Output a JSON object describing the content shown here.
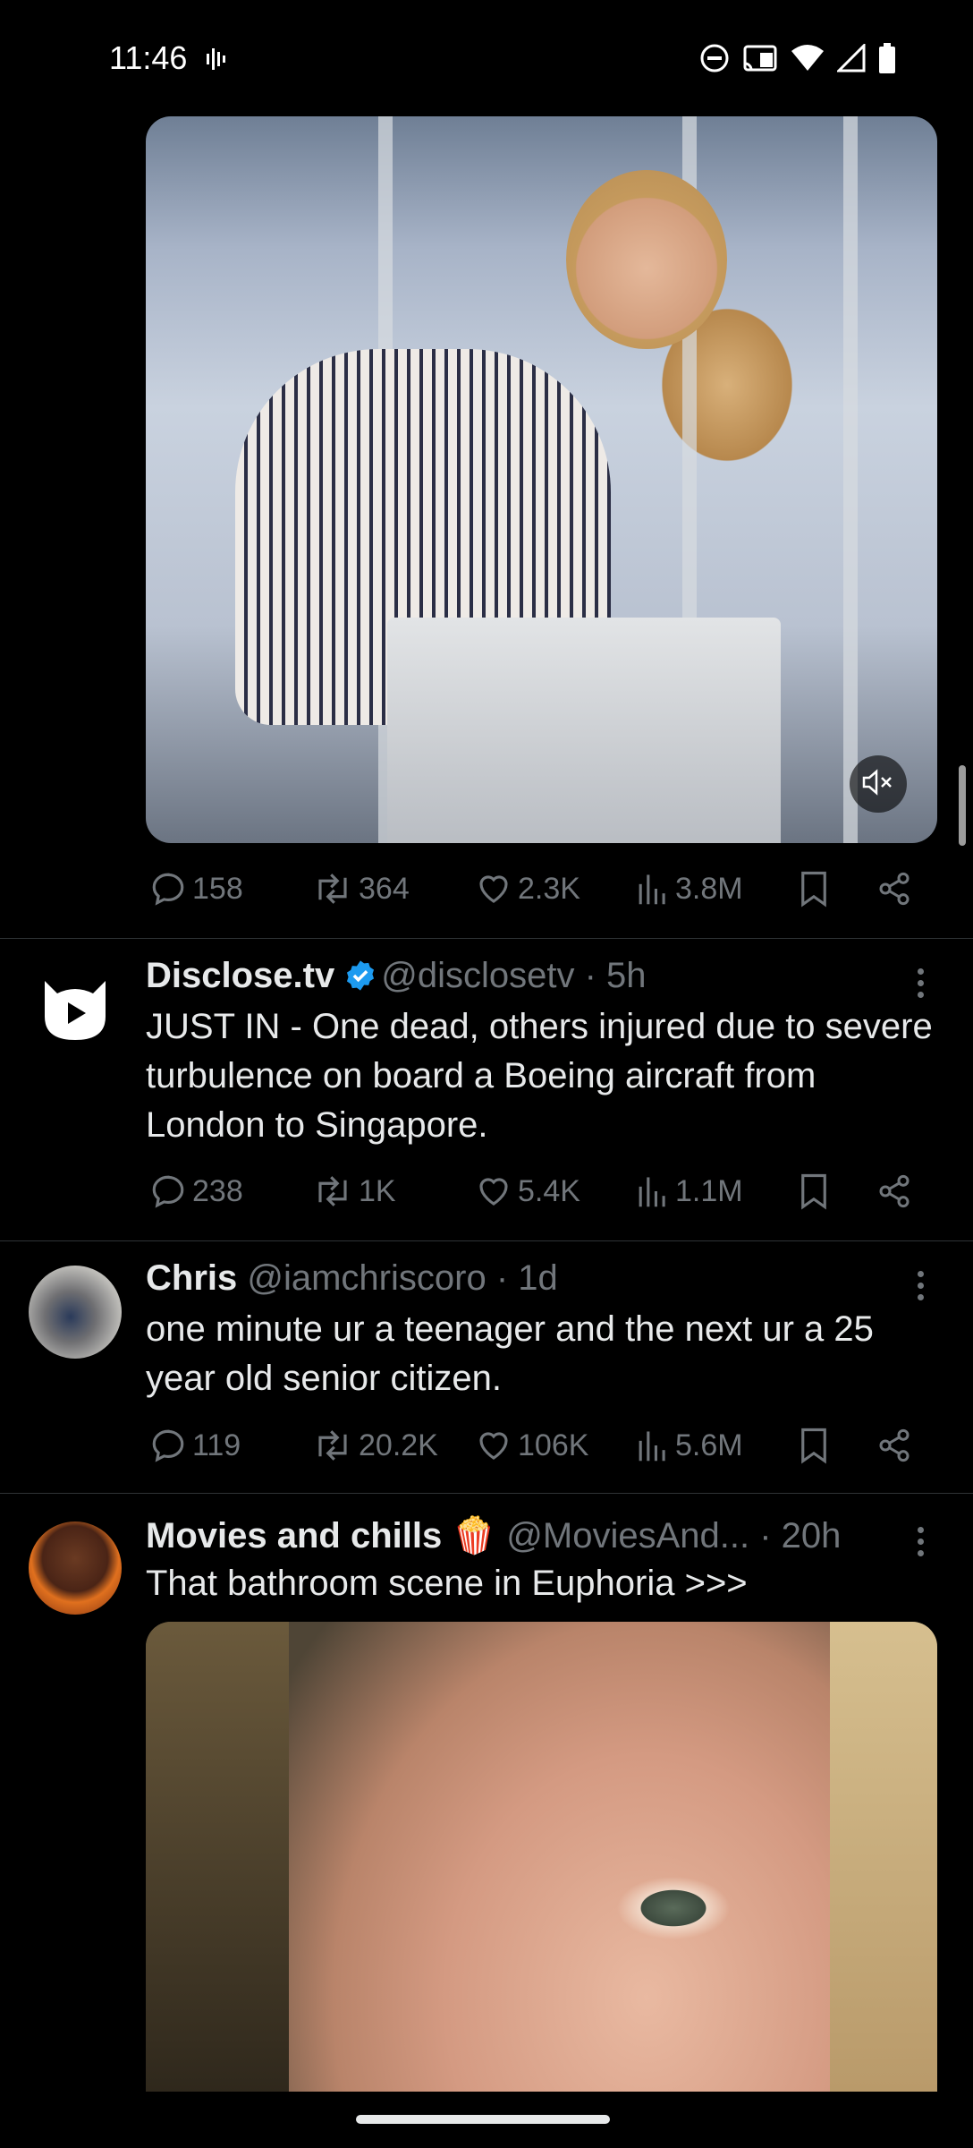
{
  "status_bar": {
    "time": "11:46"
  },
  "tweets": [
    {
      "stats": {
        "replies": "158",
        "retweets": "364",
        "likes": "2.3K",
        "views": "3.8M"
      }
    },
    {
      "display_name": "Disclose.tv",
      "verified": true,
      "handle": "@disclosetv",
      "time": "· 5h",
      "text": "JUST IN - One dead, others injured due to severe turbulence on board a Boeing aircraft from London to Singapore.",
      "stats": {
        "replies": "238",
        "retweets": "1K",
        "likes": "5.4K",
        "views": "1.1M"
      }
    },
    {
      "display_name": "Chris",
      "handle": "@iamchriscoro",
      "time": "· 1d",
      "text": "one minute ur a teenager and the next ur a 25 year old senior citizen.",
      "stats": {
        "replies": "119",
        "retweets": "20.2K",
        "likes": "106K",
        "views": "5.6M"
      }
    },
    {
      "display_name": "Movies and chills 🍿",
      "handle": "@MoviesAnd...",
      "time": "· 20h",
      "text": "That bathroom scene in Euphoria >>>"
    }
  ],
  "colors": {
    "background": "#000000",
    "text": "#e7e9ea",
    "muted": "#71767b",
    "verified": "#1d9bf0",
    "divider": "#2f3336"
  },
  "icons": [
    "reply-icon",
    "retweet-icon",
    "like-icon",
    "views-icon",
    "bookmark-icon",
    "share-icon",
    "mute-icon",
    "more-icon"
  ]
}
